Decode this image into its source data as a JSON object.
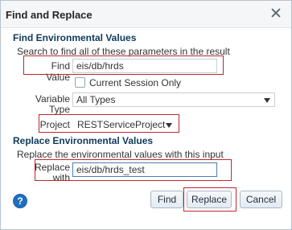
{
  "dialog": {
    "title": "Find and Replace"
  },
  "find_section": {
    "title": "Find Environmental Values",
    "description": "Search to find all of these parameters in the result",
    "find_value_label": "Find Value",
    "find_value": "eis/db/hrds",
    "current_session_label": "Current Session Only",
    "current_session_checked": false,
    "variable_type_label_line1": "Variable",
    "variable_type_label_line2": "Type",
    "variable_type_value": "All Types",
    "project_label": "Project",
    "project_value": "RESTServiceProject"
  },
  "replace_section": {
    "title": "Replace Environmental Values",
    "description": "Replace the environmental values with this input",
    "replace_label_line1": "Replace",
    "replace_label_line2": "with",
    "replace_value": "eis/db/hrds_test"
  },
  "buttons": {
    "help": "?",
    "find": "Find",
    "replace": "Replace",
    "cancel": "Cancel"
  },
  "colors": {
    "highlight": "#c0272d",
    "section_title": "#0f3a5a",
    "help_icon": "#1f6fc0"
  }
}
